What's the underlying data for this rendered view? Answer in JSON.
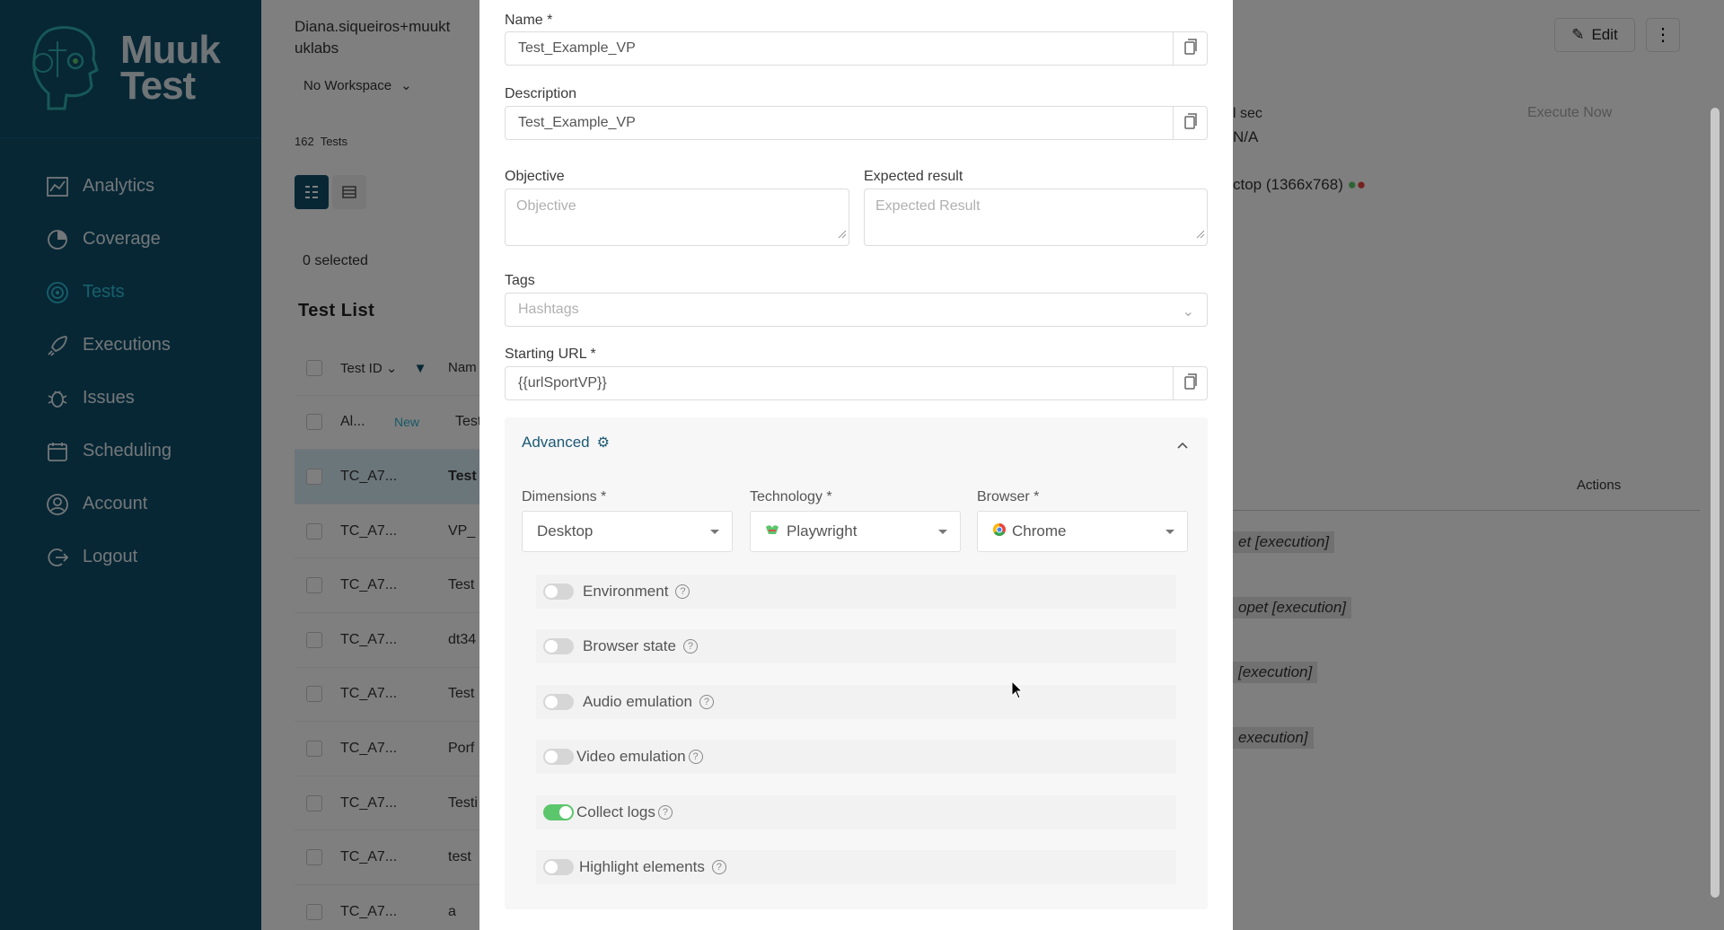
{
  "app": {
    "logo_text_1": "Muuk",
    "logo_text_2": "Test"
  },
  "sidebar": {
    "items": [
      {
        "label": "Analytics",
        "icon": "analytics-icon"
      },
      {
        "label": "Coverage",
        "icon": "coverage-icon"
      },
      {
        "label": "Tests",
        "icon": "tests-icon",
        "active": true
      },
      {
        "label": "Executions",
        "icon": "rocket-icon"
      },
      {
        "label": "Issues",
        "icon": "bug-icon"
      },
      {
        "label": "Scheduling",
        "icon": "calendar-icon"
      },
      {
        "label": "Account",
        "icon": "user-icon"
      },
      {
        "label": "Logout",
        "icon": "logout-icon"
      }
    ]
  },
  "background": {
    "user_line1": "Diana.siqueiros+muukt",
    "user_line2": "uklabs",
    "workspace": "No Workspace",
    "test_count": "162",
    "test_count_label": "Tests",
    "selected": "0 selected",
    "test_list_title": "Test List",
    "table_header_id": "Test ID",
    "table_header_name": "Nam",
    "rows": [
      {
        "id": "Al...",
        "badge": "New",
        "name": "Test"
      },
      {
        "id": "TC_A7...",
        "name": "Test"
      },
      {
        "id": "TC_A7...",
        "name": "VP_"
      },
      {
        "id": "TC_A7...",
        "name": "Test"
      },
      {
        "id": "TC_A7...",
        "name": "dt34"
      },
      {
        "id": "TC_A7...",
        "name": "Test"
      },
      {
        "id": "TC_A7...",
        "name": "Porf"
      },
      {
        "id": "TC_A7...",
        "name": "Testi"
      },
      {
        "id": "TC_A7...",
        "name": "test"
      },
      {
        "id": "TC_A7...",
        "name": "a"
      }
    ],
    "edit_label": "Edit",
    "execute_now": "Execute Now",
    "sec": "l sec",
    "na": "N/A",
    "desktop_info": "ctop (1366x768)",
    "actions": "Actions",
    "exec_tags": [
      "et [execution]",
      "opet [execution]",
      "[execution]",
      "execution]"
    ]
  },
  "modal": {
    "name_label": "Name *",
    "name_value": "Test_Example_VP",
    "description_label": "Description",
    "description_value": "Test_Example_VP",
    "objective_label": "Objective",
    "objective_placeholder": "Objective",
    "expected_label": "Expected result",
    "expected_placeholder": "Expected Result",
    "tags_label": "Tags",
    "tags_placeholder": "Hashtags",
    "url_label": "Starting URL *",
    "url_value": "{{urlSportVP}}",
    "advanced_label": "Advanced",
    "dimensions_label": "Dimensions *",
    "dimensions_value": "Desktop",
    "technology_label": "Technology *",
    "technology_value": "Playwright",
    "browser_label": "Browser *",
    "browser_value": "Chrome",
    "toggles": [
      {
        "label": "Environment",
        "on": false
      },
      {
        "label": "Browser state",
        "on": false
      },
      {
        "label": "Audio emulation",
        "on": false
      },
      {
        "label": "Video emulation",
        "on": false
      },
      {
        "label": "Collect logs",
        "on": true
      },
      {
        "label": "Highlight elements",
        "on": false
      }
    ]
  },
  "colors": {
    "sidebar": "#0e4f6b",
    "accent": "#2fc0d9",
    "toggle_on": "#5cc66d"
  }
}
